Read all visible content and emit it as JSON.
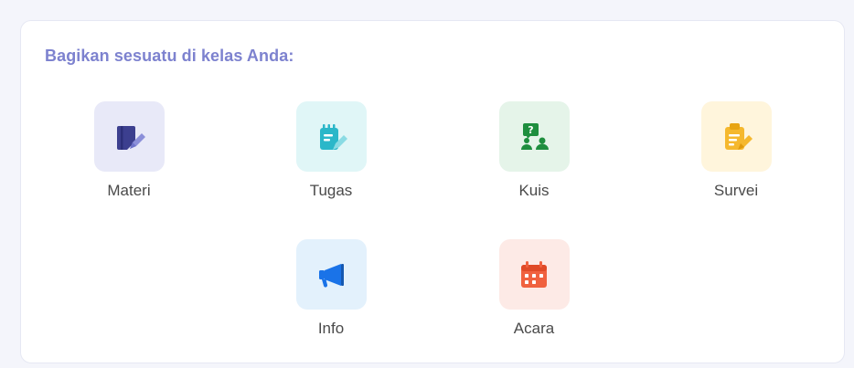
{
  "card": {
    "title": "Bagikan sesuatu di kelas Anda:"
  },
  "items": [
    {
      "label": "Materi",
      "icon": "book-pencil-icon",
      "tile_color": "#e8e9f8",
      "icon_color": "#3c3f8f"
    },
    {
      "label": "Tugas",
      "icon": "notepad-pencil-icon",
      "tile_color": "#e0f6f7",
      "icon_color": "#2bb7c9"
    },
    {
      "label": "Kuis",
      "icon": "quiz-people-icon",
      "tile_color": "#e5f4e9",
      "icon_color": "#1e8e3e"
    },
    {
      "label": "Survei",
      "icon": "clipboard-pencil-icon",
      "tile_color": "#fff5dc",
      "icon_color": "#f5b82e"
    },
    {
      "label": "Info",
      "icon": "megaphone-icon",
      "tile_color": "#e3f1fc",
      "icon_color": "#1a73e8"
    },
    {
      "label": "Acara",
      "icon": "calendar-icon",
      "tile_color": "#fdeae6",
      "icon_color": "#f0613f"
    }
  ]
}
